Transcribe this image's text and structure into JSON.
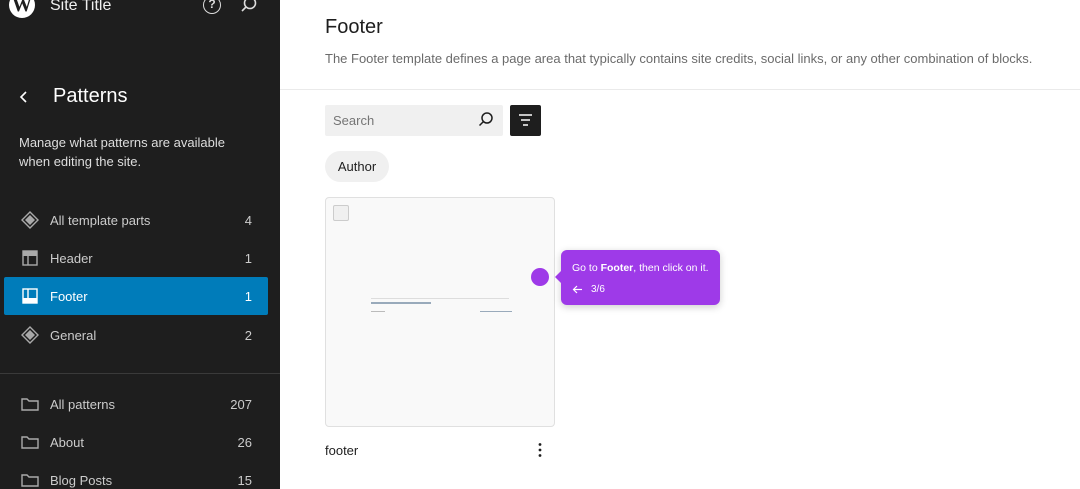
{
  "header": {
    "site_title": "Site Title",
    "logo_letter": "W",
    "help_glyph": "?"
  },
  "sidebar": {
    "title": "Patterns",
    "description": "Manage what patterns are available when editing the site.",
    "items": [
      {
        "label": "All template parts",
        "count": "4",
        "icon": "diamond-icon"
      },
      {
        "label": "Header",
        "count": "1",
        "icon": "header-layout-icon"
      },
      {
        "label": "Footer",
        "count": "1",
        "icon": "footer-layout-icon",
        "active": true
      },
      {
        "label": "General",
        "count": "2",
        "icon": "diamond-icon"
      },
      {
        "label": "All patterns",
        "count": "207",
        "icon": "folder-icon"
      },
      {
        "label": "About",
        "count": "26",
        "icon": "folder-icon"
      },
      {
        "label": "Blog Posts",
        "count": "15",
        "icon": "folder-icon"
      }
    ]
  },
  "main": {
    "title": "Footer",
    "description": "The Footer template defines a page area that typically contains site credits, social links, or any other combination of blocks.",
    "search": {
      "placeholder": "Search"
    },
    "filter_chip": "Author",
    "card": {
      "name": "footer"
    }
  },
  "tour": {
    "text_prefix": "Go to ",
    "text_bold": "Footer",
    "text_suffix": ", then click on it.",
    "step": "3/6",
    "color": "#9e3ae8"
  },
  "colors": {
    "sidebar_bg": "#1e1e1e",
    "accent": "#007cba"
  }
}
